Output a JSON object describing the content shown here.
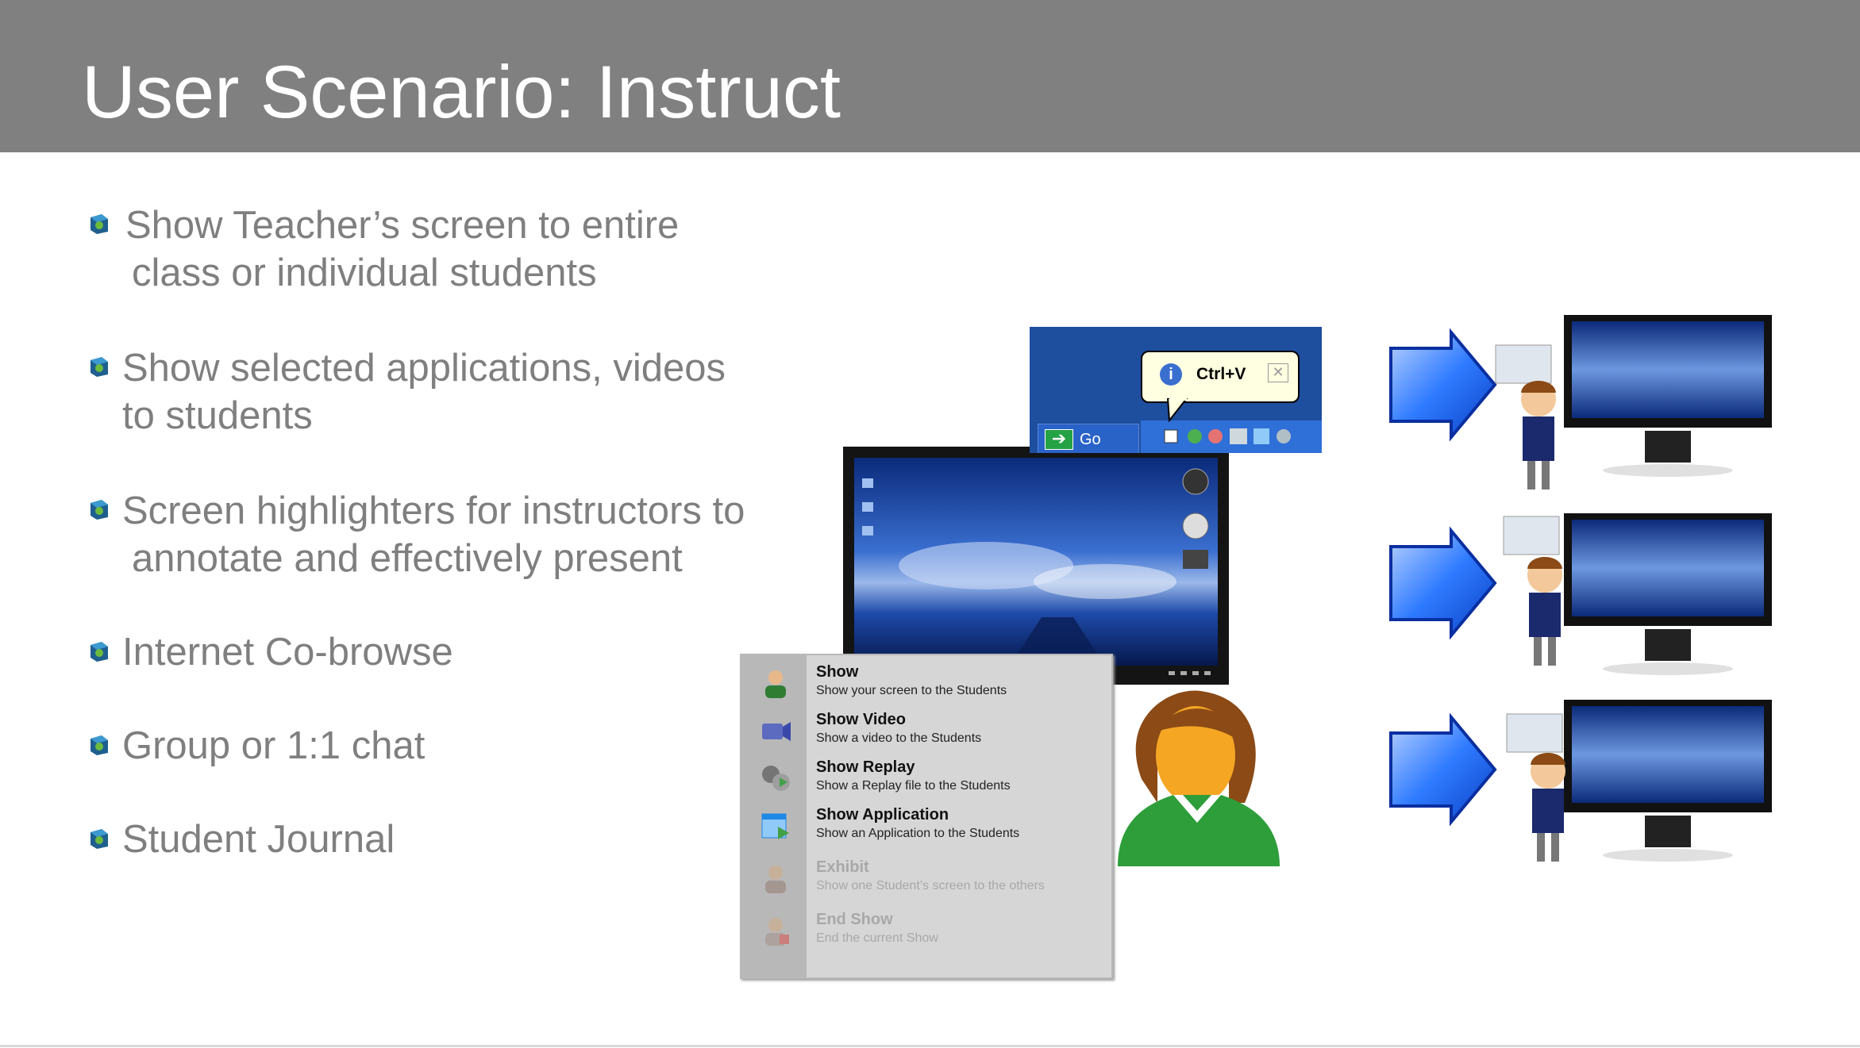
{
  "slide": {
    "title": "User Scenario: Instruct"
  },
  "bullets": [
    {
      "line1": "Show Teacher’s screen to entire",
      "line2": "class or individual students"
    },
    {
      "line1": "Show selected applications, videos",
      "line2": "to students"
    },
    {
      "line1": "Screen highlighters for instructors to",
      "line2": "annotate and effectively present"
    },
    {
      "line1": "Internet Co-browse",
      "line2": ""
    },
    {
      "line1": "Group or 1:1 chat",
      "line2": ""
    },
    {
      "line1": "Student Journal",
      "line2": ""
    }
  ],
  "taskbar": {
    "go_label": "Go",
    "balloon_text": "Ctrl+V"
  },
  "show_menu": {
    "items": [
      {
        "title": "Show",
        "desc": "Show your screen to the Students",
        "enabled": true,
        "icon": "teacher-icon"
      },
      {
        "title": "Show Video",
        "desc": "Show a video to the Students",
        "enabled": true,
        "icon": "video-camera-icon"
      },
      {
        "title": "Show Replay",
        "desc": "Show a Replay file to the Students",
        "enabled": true,
        "icon": "film-reel-icon"
      },
      {
        "title": "Show Application",
        "desc": "Show an Application to the Students",
        "enabled": true,
        "icon": "application-icon"
      },
      {
        "title": "Exhibit",
        "desc": "Show one Student’s screen to the others",
        "enabled": false,
        "icon": "student-icon"
      },
      {
        "title": "End Show",
        "desc": "End the current Show",
        "enabled": false,
        "icon": "stop-show-icon"
      }
    ]
  },
  "colors": {
    "header_bg": "#808080",
    "title": "#ffffff",
    "bullet_text": "#7f7f7f",
    "arrow_blue": "#1a5fe8",
    "menu_bg": "#d6d6d6"
  }
}
